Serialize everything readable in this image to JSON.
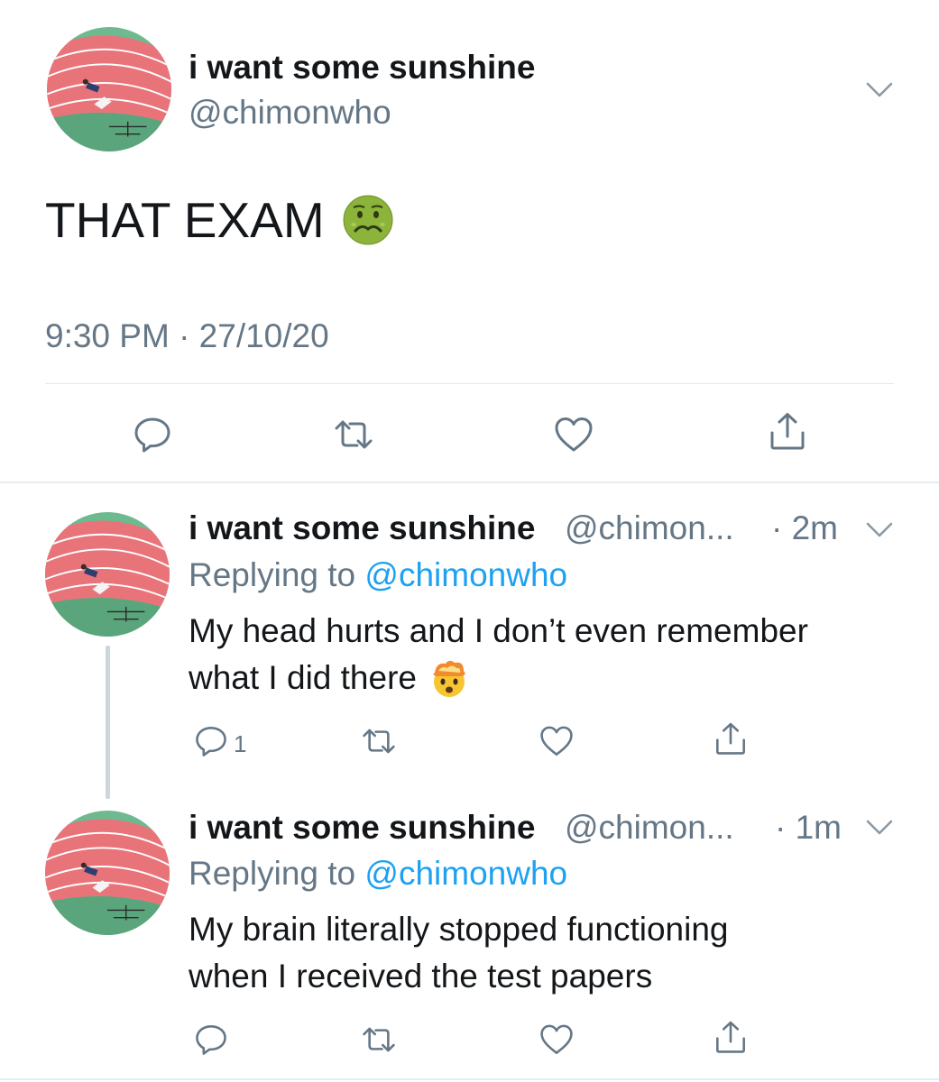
{
  "main_tweet": {
    "display_name": "i want some sunshine",
    "handle": "@chimonwho",
    "text": "THAT EXAM",
    "emoji": "nauseated-face-emoji",
    "timestamp": "9:30 PM · 27/10/20"
  },
  "replies": [
    {
      "display_name": "i want some sunshine",
      "handle": "@chimon...",
      "time": "· 2m",
      "replying_prefix": "Replying to ",
      "replying_mention": "@chimonwho",
      "text_line1": "My head hurts and I don’t even remember",
      "text_line2": "what I did there",
      "emoji": "exploding-head-emoji",
      "reply_count": "1"
    },
    {
      "display_name": "i want some sunshine",
      "handle": "@chimon...",
      "time": "· 1m",
      "replying_prefix": "Replying to ",
      "replying_mention": "@chimonwho",
      "text_line1": "My brain literally stopped functioning",
      "text_line2": "when I received the test papers"
    }
  ],
  "colors": {
    "text": "#14171a",
    "secondary": "#657786",
    "link": "#1da1f2",
    "divider": "#e1e8ed",
    "thread_line": "#ccd6dd"
  }
}
